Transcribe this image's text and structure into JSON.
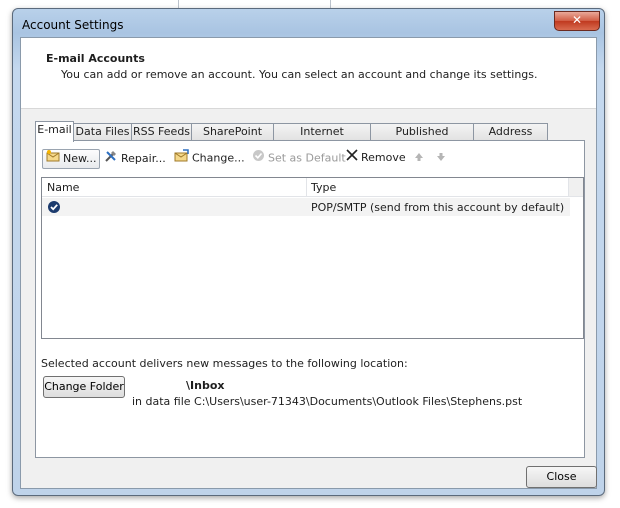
{
  "window": {
    "title": "Account Settings"
  },
  "header": {
    "title": "E-mail Accounts",
    "description": "You can add or remove an account. You can select an account and change its settings."
  },
  "tabs": [
    {
      "label": "E-mail",
      "active": true
    },
    {
      "label": "Data Files"
    },
    {
      "label": "RSS Feeds"
    },
    {
      "label": "SharePoint Lists"
    },
    {
      "label": "Internet Calendars"
    },
    {
      "label": "Published Calendars"
    },
    {
      "label": "Address Books"
    }
  ],
  "toolbar": {
    "new": "New...",
    "repair": "Repair...",
    "change": "Change...",
    "set_default": "Set as Default",
    "remove": "Remove"
  },
  "list": {
    "columns": {
      "name": "Name",
      "type": "Type"
    },
    "rows": [
      {
        "name": "",
        "type": "POP/SMTP (send from this account by default)"
      }
    ]
  },
  "delivery": {
    "label": "Selected account delivers new messages to the following location:",
    "change_folder": "Change Folder",
    "folder": "\\Inbox",
    "data_file": "in data file C:\\Users\\user-71343\\Documents\\Outlook Files\\Stephens.pst"
  },
  "footer": {
    "close": "Close"
  },
  "colors": {
    "accent": "#1b5fb0",
    "close_button": "#c0391f"
  }
}
